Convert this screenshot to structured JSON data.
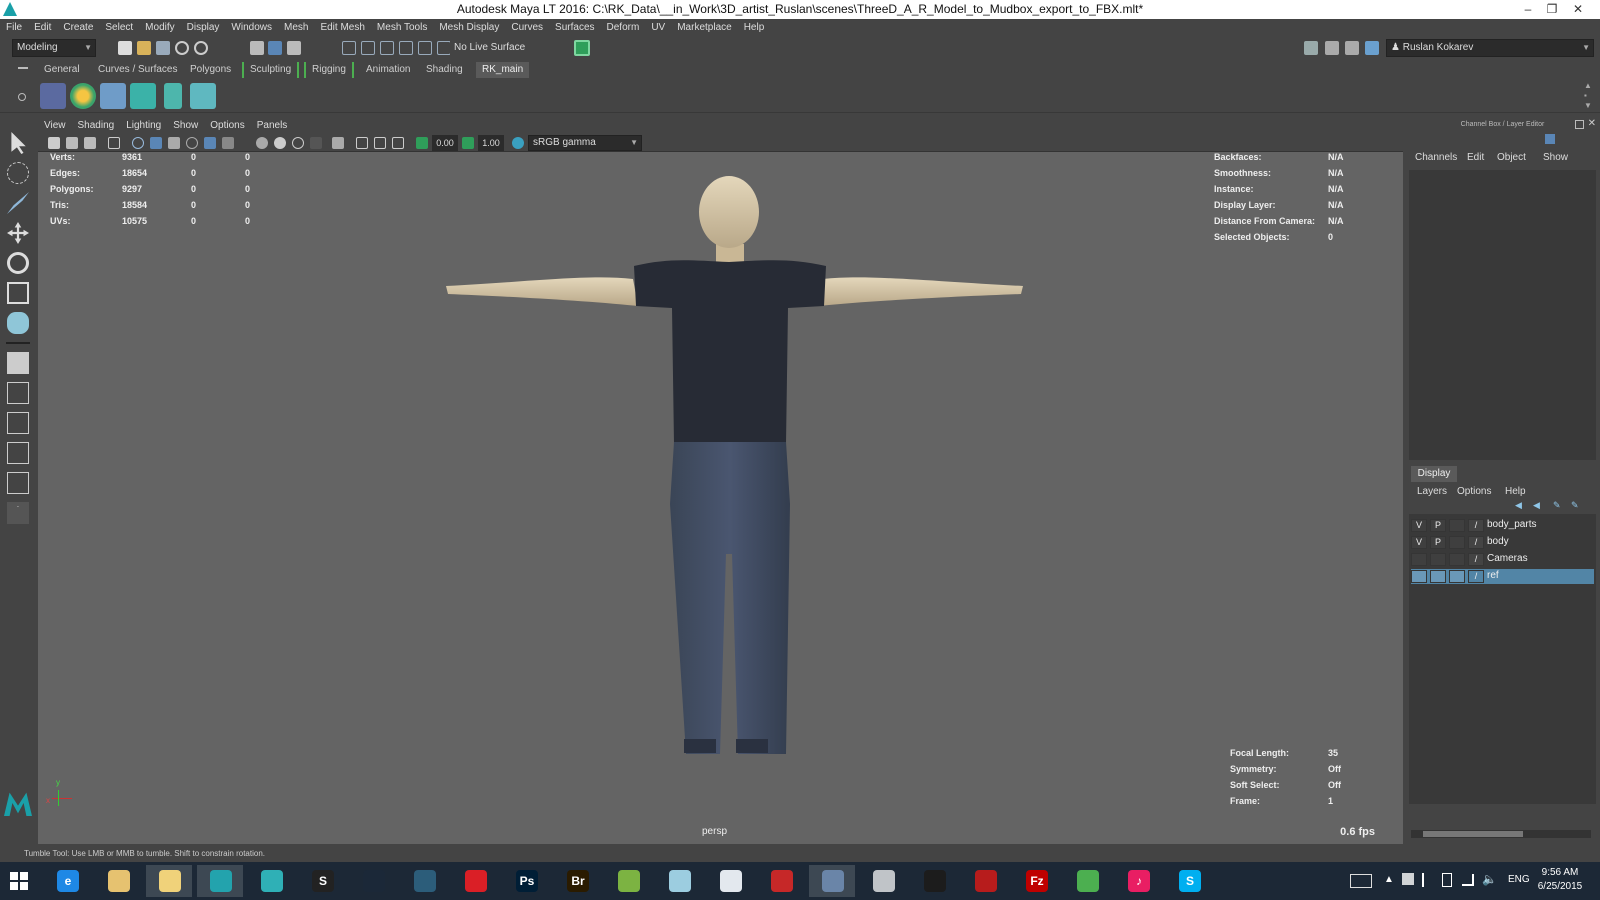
{
  "window": {
    "title": "Autodesk Maya LT 2016: C:\\RK_Data\\__in_Work\\3D_artist_Ruslan\\scenes\\ThreeD_A_R_Model_to_Mudbox_export_to_FBX.mlt*",
    "min": "–",
    "restore": "❐",
    "close": "✕"
  },
  "menubar": [
    "File",
    "Edit",
    "Create",
    "Select",
    "Modify",
    "Display",
    "Windows",
    "Mesh",
    "Edit Mesh",
    "Mesh Tools",
    "Mesh Display",
    "Curves",
    "Surfaces",
    "Deform",
    "UV",
    "Marketplace",
    "Help"
  ],
  "statusline": {
    "mode": "Modeling",
    "live_surface": "No Live Surface",
    "user": "Ruslan Kokarev"
  },
  "shelf_tabs": [
    "General",
    "Curves / Surfaces",
    "Polygons",
    "Sculpting",
    "Rigging",
    "Animation",
    "Shading",
    "RK_main"
  ],
  "shelf_active": "RK_main",
  "viewport": {
    "menu": [
      "View",
      "Shading",
      "Lighting",
      "Show",
      "Options",
      "Panels"
    ],
    "exposure": "0.00",
    "gamma": "1.00",
    "color_space": "sRGB gamma",
    "stats": [
      {
        "label": "Verts:",
        "v1": "9361",
        "v2": "0",
        "v3": "0"
      },
      {
        "label": "Edges:",
        "v1": "18654",
        "v2": "0",
        "v3": "0"
      },
      {
        "label": "Polygons:",
        "v1": "9297",
        "v2": "0",
        "v3": "0"
      },
      {
        "label": "Tris:",
        "v1": "18584",
        "v2": "0",
        "v3": "0"
      },
      {
        "label": "UVs:",
        "v1": "10575",
        "v2": "0",
        "v3": "0"
      }
    ],
    "info": [
      {
        "label": "Backfaces:",
        "value": "N/A"
      },
      {
        "label": "Smoothness:",
        "value": "N/A"
      },
      {
        "label": "Instance:",
        "value": "N/A"
      },
      {
        "label": "Display Layer:",
        "value": "N/A"
      },
      {
        "label": "Distance From Camera:",
        "value": "N/A"
      },
      {
        "label": "Selected Objects:",
        "value": "0"
      }
    ],
    "camera_info": [
      {
        "label": "Focal Length:",
        "value": "35"
      },
      {
        "label": "Symmetry:",
        "value": "Off"
      },
      {
        "label": "Soft Select:",
        "value": "Off"
      },
      {
        "label": "Frame:",
        "value": "1"
      }
    ],
    "camera": "persp",
    "fps": "0.6 fps",
    "axis_x": "x",
    "axis_y": "y"
  },
  "channel_box": {
    "header": "Channel Box / Layer Editor",
    "menu": [
      "Channels",
      "Edit",
      "Object",
      "Show"
    ]
  },
  "layer_editor": {
    "tab": "Display",
    "menu": [
      "Layers",
      "Options",
      "Help"
    ],
    "layers": [
      {
        "v": "V",
        "p": "P",
        "name": "body_parts",
        "selected": false
      },
      {
        "v": "V",
        "p": "P",
        "name": "body",
        "selected": false
      },
      {
        "v": "",
        "p": "",
        "name": "Cameras",
        "selected": false
      },
      {
        "v": "",
        "p": "",
        "name": "ref",
        "selected": true
      }
    ]
  },
  "helpline": "Tumble Tool: Use LMB or MMB to tumble. Shift to constrain rotation.",
  "taskbar": {
    "apps": [
      {
        "name": "Internet Explorer",
        "glyph": "e",
        "color": "#1e88e5"
      },
      {
        "name": "Explorer",
        "glyph": "",
        "color": "#e6c270"
      },
      {
        "name": "Files",
        "glyph": "",
        "color": "#f0d27a"
      },
      {
        "name": "Maya LT",
        "glyph": "",
        "color": "#23a3ad"
      },
      {
        "name": "Mudbox",
        "glyph": "",
        "color": "#2fb0b6"
      },
      {
        "name": "Substance",
        "glyph": "S",
        "color": "#222"
      },
      {
        "name": "Steam",
        "glyph": "",
        "color": "#1b2838"
      },
      {
        "name": "Globe app",
        "glyph": "",
        "color": "#2c5d7a"
      },
      {
        "name": "Creative Cloud",
        "glyph": "",
        "color": "#da1f26"
      },
      {
        "name": "Photoshop",
        "glyph": "Ps",
        "color": "#001e36"
      },
      {
        "name": "Bridge",
        "glyph": "Br",
        "color": "#2a1b00"
      },
      {
        "name": "Spreadsheet",
        "glyph": "",
        "color": "#7cb342"
      },
      {
        "name": "Notes",
        "glyph": "",
        "color": "#9ccde0"
      },
      {
        "name": "Calculator",
        "glyph": "",
        "color": "#e3e8ee"
      },
      {
        "name": "Snipping",
        "glyph": "",
        "color": "#c62828"
      },
      {
        "name": "Display settings",
        "glyph": "",
        "color": "#6a85a8"
      },
      {
        "name": "Printer",
        "glyph": "",
        "color": "#c0c4c8"
      },
      {
        "name": "Camera app",
        "glyph": "",
        "color": "#1c1c1c"
      },
      {
        "name": "App red",
        "glyph": "",
        "color": "#b71c1c"
      },
      {
        "name": "FileZilla",
        "glyph": "Fz",
        "color": "#bf0000"
      },
      {
        "name": "Globe",
        "glyph": "",
        "color": "#4caf50"
      },
      {
        "name": "iTunes",
        "glyph": "♪",
        "color": "#e91e63"
      },
      {
        "name": "Skype",
        "glyph": "S",
        "color": "#00aff0"
      }
    ],
    "lang": "ENG",
    "time": "9:56 AM",
    "date": "6/25/2015"
  }
}
